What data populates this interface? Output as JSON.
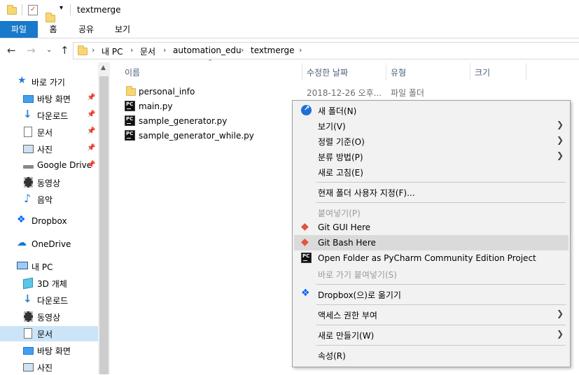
{
  "window": {
    "title": "textmerge"
  },
  "ribbon": {
    "tabs": [
      "파일",
      "홈",
      "공유",
      "보기"
    ]
  },
  "breadcrumb": [
    "내 PC",
    "문서",
    "automation_edu",
    "textmerge"
  ],
  "sidebar": {
    "items": [
      {
        "label": "바로 가기",
        "icon": "star-icon"
      },
      {
        "label": "바탕 화면",
        "icon": "desktop-icon",
        "pinned": true
      },
      {
        "label": "다운로드",
        "icon": "download-icon",
        "pinned": true
      },
      {
        "label": "문서",
        "icon": "document-icon",
        "pinned": true
      },
      {
        "label": "사진",
        "icon": "picture-icon",
        "pinned": true
      },
      {
        "label": "Google Drive",
        "icon": "drive-icon",
        "pinned": true
      },
      {
        "label": "동영상",
        "icon": "video-icon"
      },
      {
        "label": "음악",
        "icon": "music-icon"
      },
      {
        "label": "Dropbox",
        "icon": "dropbox-icon"
      },
      {
        "label": "OneDrive",
        "icon": "onedrive-icon"
      },
      {
        "label": "내 PC",
        "icon": "pc-icon"
      },
      {
        "label": "3D 개체",
        "icon": "cube-icon"
      },
      {
        "label": "다운로드",
        "icon": "download-icon"
      },
      {
        "label": "동영상",
        "icon": "video-icon"
      },
      {
        "label": "문서",
        "icon": "document-icon",
        "selected": true
      },
      {
        "label": "바탕 화면",
        "icon": "desktop-icon"
      },
      {
        "label": "사진",
        "icon": "picture-icon"
      }
    ]
  },
  "columns": [
    "이름",
    "수정한 날짜",
    "유형",
    "크기"
  ],
  "files": [
    {
      "name": "personal_info",
      "modified": "2018-12-26 오후...",
      "type": "파일 폴더",
      "icon": "folder-icon"
    },
    {
      "name": "main.py",
      "icon": "pycharm-file-icon"
    },
    {
      "name": "sample_generator.py",
      "icon": "pycharm-file-icon"
    },
    {
      "name": "sample_generator_while.py",
      "icon": "pycharm-file-icon"
    }
  ],
  "context_menu": {
    "items": [
      {
        "label": "새 폴더(N)",
        "icon": "new-folder-icon"
      },
      {
        "label": "보기(V)",
        "submenu": true
      },
      {
        "label": "정렬 기준(O)",
        "submenu": true
      },
      {
        "label": "분류 방법(P)",
        "submenu": true
      },
      {
        "label": "새로 고침(E)"
      },
      {
        "label": "현재 폴더 사용자 지정(F)..."
      },
      {
        "label": "붙여넣기(P)",
        "disabled": true
      },
      {
        "label": "Git GUI Here",
        "icon": "git-icon"
      },
      {
        "label": "Git Bash Here",
        "icon": "git-icon",
        "highlighted": true
      },
      {
        "label": "Open Folder as PyCharm Community Edition Project",
        "icon": "pycharm-icon"
      },
      {
        "label": "바로 가기 붙여넣기(S)",
        "disabled": true
      },
      {
        "label": "Dropbox(으)로 옮기기",
        "icon": "dropbox-icon"
      },
      {
        "label": "액세스 권한 부여",
        "submenu": true
      },
      {
        "label": "새로 만들기(W)",
        "submenu": true
      },
      {
        "label": "속성(R)"
      }
    ]
  },
  "colors": {
    "accent": "#1979ca",
    "selection": "#cce4f7",
    "menu_bg": "#f2f2f2",
    "menu_highlight": "#dadada",
    "folder": "#f7d675"
  }
}
